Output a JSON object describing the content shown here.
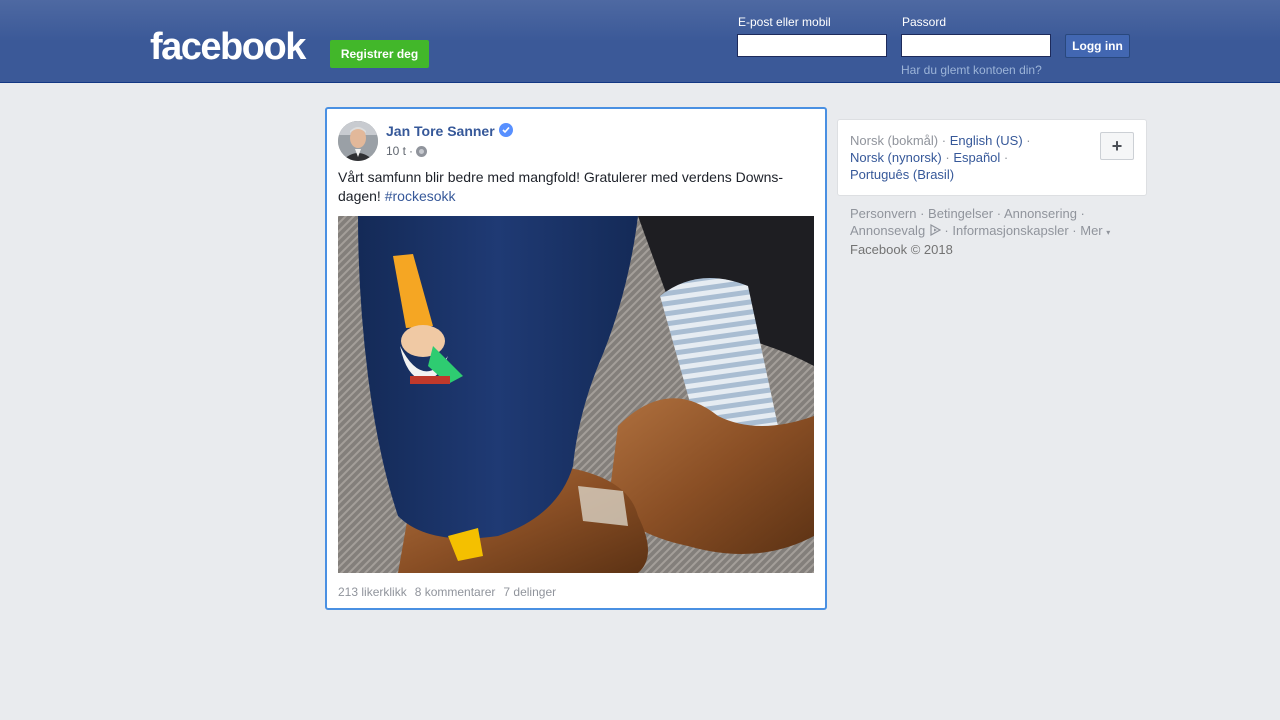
{
  "header": {
    "logo": "facebook",
    "register_label": "Registrer deg",
    "email_label": "E-post eller mobil",
    "password_label": "Passord",
    "login_label": "Logg inn",
    "forgot_label": "Har du glemt kontoen din?",
    "email_value": "",
    "password_value": ""
  },
  "post": {
    "author": "Jan Tore Sanner",
    "time": "10 t",
    "separator": "·",
    "text": "Vårt samfunn blir bedre med mangfold! Gratulerer med verdens Downs-dagen!",
    "hashtag": "#rockesokk",
    "likes": "213 likerklikk",
    "comments": "8 kommentarer",
    "shares": "7 delinger"
  },
  "languages": {
    "current": "Norsk (bokmål)",
    "items": [
      "English (US)",
      "Norsk (nynorsk)",
      "Español",
      "Português (Brasil)"
    ],
    "more_label": "+"
  },
  "footer": {
    "links": [
      "Personvern",
      "Betingelser",
      "Annonsering",
      "Annonsevalg",
      "Informasjonskapsler",
      "Mer"
    ],
    "copyright": "Facebook © 2018"
  },
  "colors": {
    "brand": "#3b5998",
    "link": "#365899",
    "register_green": "#42b72a",
    "focus_border": "#4a90e2"
  },
  "icons": [
    "verified-badge-icon",
    "globe-icon",
    "adchoices-icon",
    "caret-down-icon",
    "plus-icon"
  ]
}
